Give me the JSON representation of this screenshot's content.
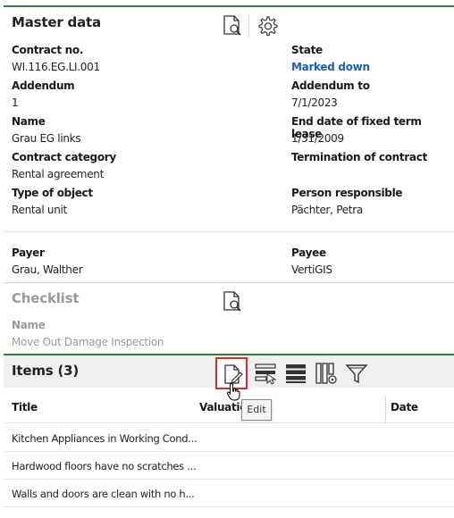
{
  "master": {
    "title": "Master data",
    "fields": {
      "contract_no_label": "Contract no.",
      "contract_no": "WI.116.EG.LI.001",
      "state_label": "State",
      "state": "Marked down",
      "addendum_label": "Addendum",
      "addendum": "1",
      "addendum_to_label": "Addendum to",
      "addendum_to": "7/1/2023",
      "name_label": "Name",
      "name": "Grau EG links",
      "end_date_label": "End date of fixed term lease",
      "end_date": "1/31/2009",
      "category_label": "Contract category",
      "category": "Rental agreement",
      "termination_label": "Termination of contract",
      "object_type_label": "Type of object",
      "object_type": "Rental unit",
      "person_label": "Person responsible",
      "person": "Pächter, Petra",
      "payer_label": "Payer",
      "payer": "Grau, Walther",
      "payee_label": "Payee",
      "payee": "VertiGIS"
    },
    "icons": [
      "document-search-icon",
      "gear-icon"
    ]
  },
  "checklist": {
    "title": "Checklist",
    "name_label": "Name",
    "name": "Move Out Damage Inspection",
    "icon": "document-search-icon"
  },
  "items": {
    "title": "Items (3)",
    "toolbar_icons": [
      "edit-document-icon",
      "select-rows-icon",
      "list-view-icon",
      "column-settings-icon",
      "filter-icon"
    ],
    "tooltip": "Edit",
    "columns": [
      "Title",
      "Valuatio",
      "Date"
    ],
    "rows": [
      "Kitchen Appliances in Working Cond...",
      "Hardwood floors have no scratches ...",
      "Walls and doors are clean with no h..."
    ]
  },
  "colors": {
    "accent_green": "#2e7d45",
    "link_blue": "#1a5fb4",
    "highlight_red": "#d32f2f",
    "muted_gray": "#9a9a9a"
  }
}
